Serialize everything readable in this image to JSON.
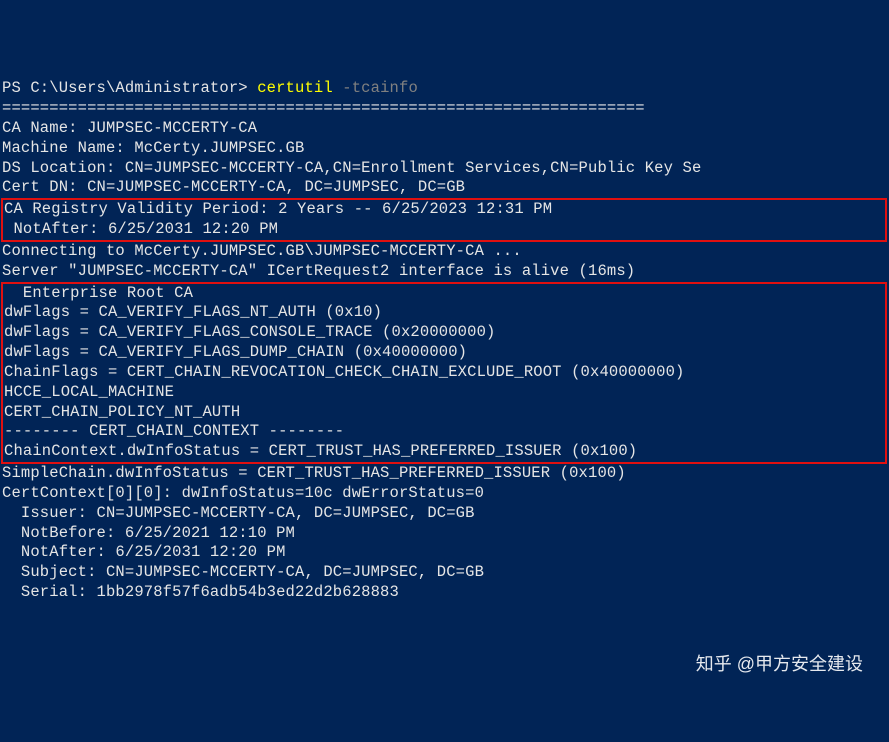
{
  "prompt": {
    "path": "PS C:\\Users\\Administrator> ",
    "command": "certutil",
    "argument": " -tcainfo"
  },
  "divider": "====================================================================",
  "ca_name": "CA Name: JUMPSEC-MCCERTY-CA",
  "blank": "",
  "machine_name": "Machine Name: McCerty.JUMPSEC.GB",
  "ds_location": "DS Location: CN=JUMPSEC-MCCERTY-CA,CN=Enrollment Services,CN=Public Key Se",
  "cert_dn": "Cert DN: CN=JUMPSEC-MCCERTY-CA, DC=JUMPSEC, DC=GB",
  "validity_period": "CA Registry Validity Period: 2 Years -- 6/25/2023 12:31 PM",
  "not_after_box": " NotAfter: 6/25/2031 12:20 PM",
  "connecting": "Connecting to McCerty.JUMPSEC.GB\\JUMPSEC-MCCERTY-CA ...",
  "server_alive": "Server \"JUMPSEC-MCCERTY-CA\" ICertRequest2 interface is alive (16ms)",
  "enterprise_root": "  Enterprise Root CA",
  "dwflags1": "dwFlags = CA_VERIFY_FLAGS_NT_AUTH (0x10)",
  "dwflags2": "dwFlags = CA_VERIFY_FLAGS_CONSOLE_TRACE (0x20000000)",
  "dwflags3": "dwFlags = CA_VERIFY_FLAGS_DUMP_CHAIN (0x40000000)",
  "chainflags": "ChainFlags = CERT_CHAIN_REVOCATION_CHECK_CHAIN_EXCLUDE_ROOT (0x40000000)",
  "hcce": "HCCE_LOCAL_MACHINE",
  "cert_chain_policy": "CERT_CHAIN_POLICY_NT_AUTH",
  "chain_context_header": "-------- CERT_CHAIN_CONTEXT --------",
  "chain_context_info": "ChainContext.dwInfoStatus = CERT_TRUST_HAS_PREFERRED_ISSUER (0x100)",
  "simple_chain": "SimpleChain.dwInfoStatus = CERT_TRUST_HAS_PREFERRED_ISSUER (0x100)",
  "cert_context": "CertContext[0][0]: dwInfoStatus=10c dwErrorStatus=0",
  "issuer": "  Issuer: CN=JUMPSEC-MCCERTY-CA, DC=JUMPSEC, DC=GB",
  "not_before": "  NotBefore: 6/25/2021 12:10 PM",
  "not_after2": "  NotAfter: 6/25/2031 12:20 PM",
  "subject": "  Subject: CN=JUMPSEC-MCCERTY-CA, DC=JUMPSEC, DC=GB",
  "serial": "  Serial: 1bb2978f57f6adb54b3ed22d2b628883",
  "watermark": "知乎 @甲方安全建设"
}
